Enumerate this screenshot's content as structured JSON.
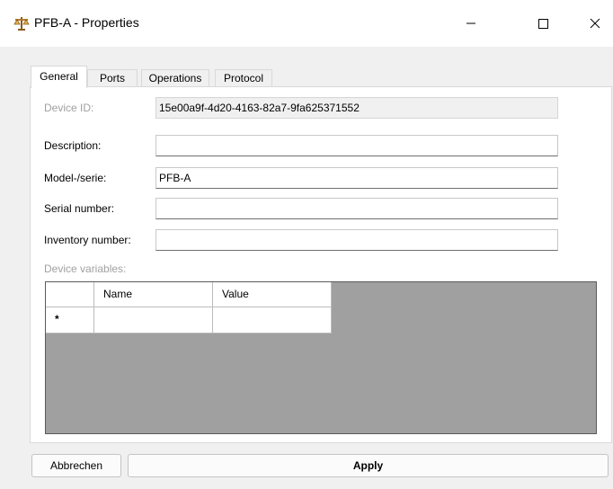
{
  "window": {
    "title": "PFB-A - Properties",
    "icon": "scale-icon",
    "controls": {
      "minimize": "—",
      "maximize": "☐",
      "close": "✕"
    }
  },
  "tabs": [
    {
      "label": "General",
      "active": true
    },
    {
      "label": "Ports",
      "active": false
    },
    {
      "label": "Operations",
      "active": false
    },
    {
      "label": "Protocol",
      "active": false
    }
  ],
  "general": {
    "device_id": {
      "label": "Device ID:",
      "value": "15e00a9f-4d20-4163-82a7-9fa625371552"
    },
    "description": {
      "label": "Description:",
      "value": ""
    },
    "model": {
      "label": "Model-/serie:",
      "value": "PFB-A"
    },
    "serial": {
      "label": "Serial number:",
      "value": ""
    },
    "inventory": {
      "label": "Inventory number:",
      "value": ""
    },
    "variables_label": "Device variables:"
  },
  "variables_grid": {
    "columns": [
      "Name",
      "Value"
    ],
    "new_row_marker": "*",
    "rows": []
  },
  "buttons": {
    "cancel": "Abbrechen",
    "apply": "Apply"
  }
}
